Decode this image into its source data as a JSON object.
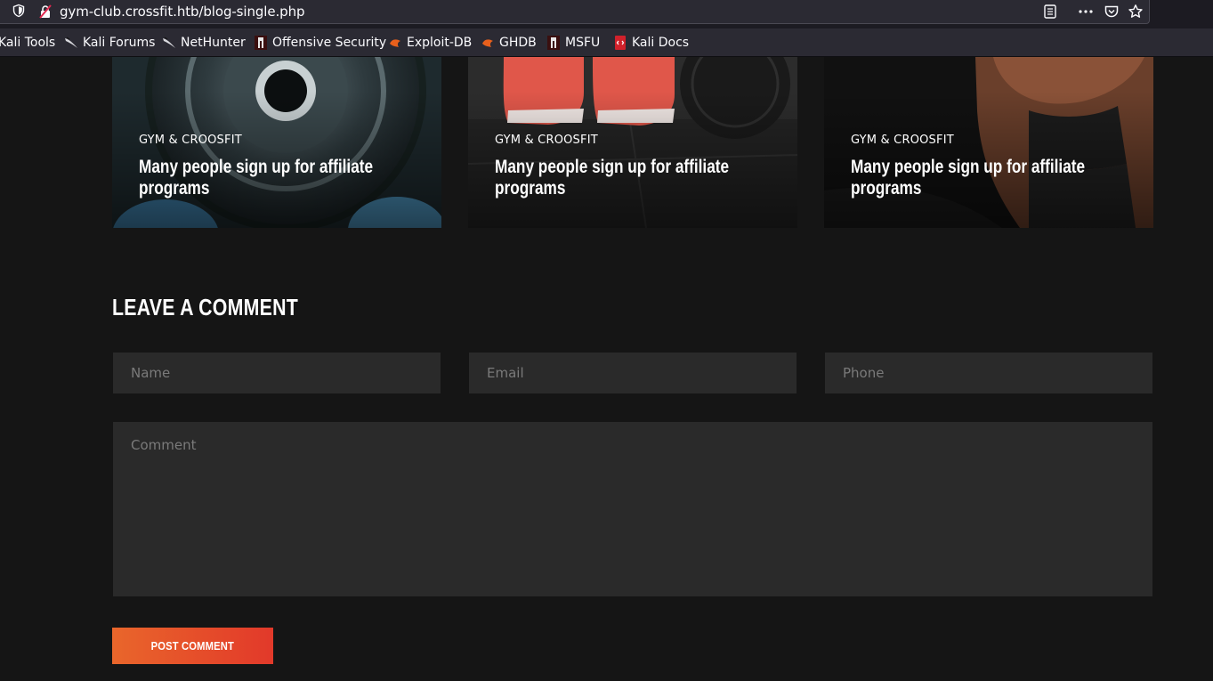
{
  "browser": {
    "url": "gym-club.crossfit.htb/blog-single.php",
    "bookmarks": [
      {
        "label": "Kali Tools",
        "icon": "kali-icon"
      },
      {
        "label": "Kali Forums",
        "icon": "kali-dragon-icon"
      },
      {
        "label": "NetHunter",
        "icon": "kali-dragon-icon"
      },
      {
        "label": "Offensive Security",
        "icon": "offsec-icon"
      },
      {
        "label": "Exploit-DB",
        "icon": "exploitdb-icon"
      },
      {
        "label": "GHDB",
        "icon": "exploitdb-icon"
      },
      {
        "label": "MSFU",
        "icon": "offsec-icon"
      },
      {
        "label": "Kali Docs",
        "icon": "kali-docs-icon"
      }
    ]
  },
  "related_posts": [
    {
      "category": "GYM & CROOSFIT",
      "title": "Many people sign up for affiliate programs",
      "image": "weight-plate-photo"
    },
    {
      "category": "GYM & CROOSFIT",
      "title": "Many people sign up for affiliate programs",
      "image": "red-sneakers-photo"
    },
    {
      "category": "GYM & CROOSFIT",
      "title": "Many people sign up for affiliate programs",
      "image": "athlete-back-photo"
    }
  ],
  "comment_form": {
    "heading": "LEAVE A COMMENT",
    "name_placeholder": "Name",
    "email_placeholder": "Email",
    "phone_placeholder": "Phone",
    "comment_placeholder": "Comment",
    "submit_label": "POST COMMENT"
  },
  "colors": {
    "page_bg": "#151515",
    "field_bg": "#2a2a2a",
    "accent_start": "#e9662b",
    "accent_end": "#e2392a"
  }
}
